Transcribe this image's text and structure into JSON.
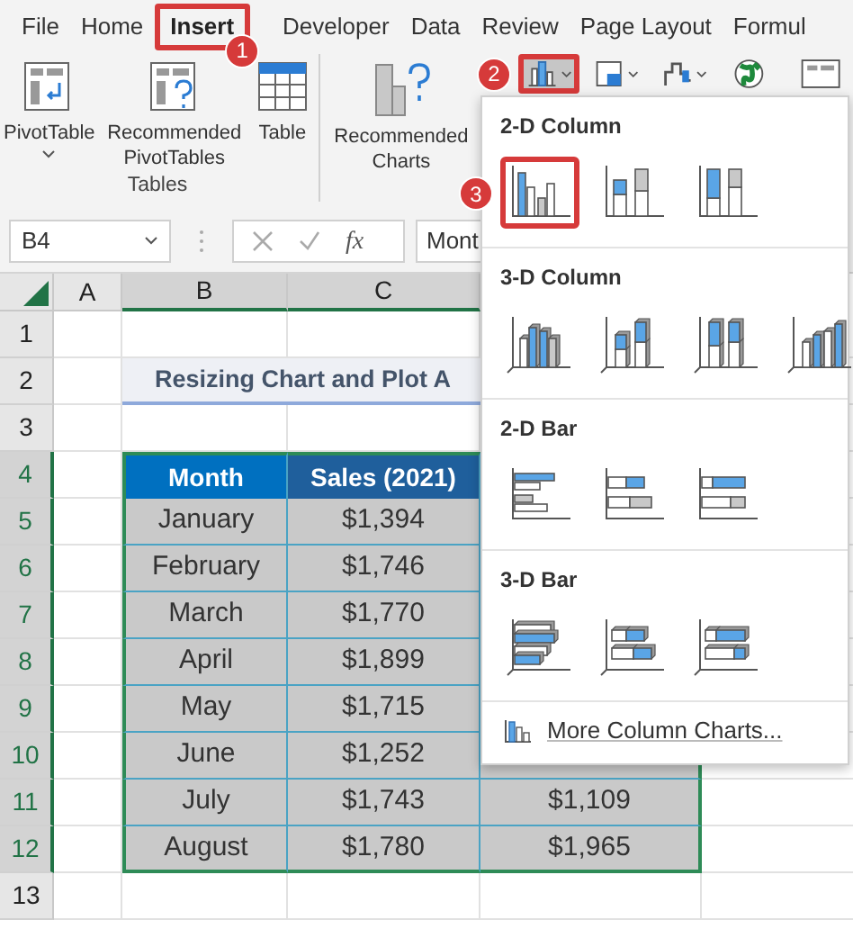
{
  "ribbon_tabs": [
    {
      "label": "File",
      "selected": false
    },
    {
      "label": "Home",
      "selected": false
    },
    {
      "label": "Insert",
      "selected": true,
      "badge": "1"
    },
    {
      "label": "Developer",
      "selected": false
    },
    {
      "label": "Data",
      "selected": false
    },
    {
      "label": "Review",
      "selected": false
    },
    {
      "label": "Page Layout",
      "selected": false
    },
    {
      "label": "Formul",
      "selected": false
    }
  ],
  "ribbon": {
    "tables_group": {
      "label": "Tables",
      "buttons": [
        {
          "kind": "pivottable",
          "label": "PivotTable",
          "has_menu": true
        },
        {
          "kind": "recommended",
          "label": "Recommended PivotTables",
          "has_menu": false
        },
        {
          "kind": "table",
          "label": "Table",
          "has_menu": false
        }
      ]
    },
    "recommended_charts": {
      "label": "Recommended Charts"
    },
    "chart_buttons": [
      {
        "kind": "column",
        "selected": true,
        "badge": "2"
      },
      {
        "kind": "hierarchy",
        "selected": false
      },
      {
        "kind": "waterfall",
        "selected": false
      },
      {
        "kind": "map",
        "selected": false
      },
      {
        "kind": "pivotchart",
        "selected": false
      }
    ]
  },
  "formula_bar": {
    "name_box": "B4",
    "function_label": "fx",
    "content": "Mont"
  },
  "column_headers": [
    {
      "label": "A",
      "selected": false
    },
    {
      "label": "B",
      "selected": true
    },
    {
      "label": "C",
      "selected": true
    }
  ],
  "row_headers": [
    {
      "label": "1",
      "selected": false
    },
    {
      "label": "2",
      "selected": false
    },
    {
      "label": "3",
      "selected": false
    },
    {
      "label": "4",
      "selected": true
    },
    {
      "label": "5",
      "selected": true
    },
    {
      "label": "6",
      "selected": true
    },
    {
      "label": "7",
      "selected": true
    },
    {
      "label": "8",
      "selected": true
    },
    {
      "label": "9",
      "selected": true
    },
    {
      "label": "10",
      "selected": true
    },
    {
      "label": "11",
      "selected": true
    },
    {
      "label": "12",
      "selected": true
    },
    {
      "label": "13",
      "selected": false
    }
  ],
  "sheet_title": "Resizing Chart and Plot A",
  "table": {
    "columns": [
      "Month",
      "Sales (2021)"
    ],
    "rows": [
      {
        "month": "January",
        "sales_2021": "$1,394"
      },
      {
        "month": "February",
        "sales_2021": "$1,746"
      },
      {
        "month": "March",
        "sales_2021": "$1,770"
      },
      {
        "month": "April",
        "sales_2021": "$1,899"
      },
      {
        "month": "May",
        "sales_2021": "$1,715"
      },
      {
        "month": "June",
        "sales_2021": "$1,252"
      },
      {
        "month": "July",
        "sales_2021": "$1,743",
        "column_3": "$1,109"
      },
      {
        "month": "August",
        "sales_2021": "$1,780",
        "column_3": "$1,965"
      }
    ]
  },
  "chart_menu": {
    "sections": [
      {
        "title": "2-D Column",
        "kind": "column",
        "options": [
          {
            "kind": "clustered",
            "selected": true,
            "badge": "3"
          },
          {
            "kind": "stacked",
            "selected": false
          },
          {
            "kind": "percent",
            "selected": false
          }
        ]
      },
      {
        "title": "3-D Column",
        "kind": "column3d",
        "options": [
          {
            "kind": "clustered",
            "selected": false
          },
          {
            "kind": "stacked",
            "selected": false
          },
          {
            "kind": "percent",
            "selected": false
          },
          {
            "kind": "depth",
            "selected": false
          }
        ]
      },
      {
        "title": "2-D Bar",
        "kind": "bar",
        "options": [
          {
            "kind": "clustered",
            "selected": false
          },
          {
            "kind": "stacked",
            "selected": false
          },
          {
            "kind": "percent",
            "selected": false
          }
        ]
      },
      {
        "title": "3-D Bar",
        "kind": "bar3d",
        "options": [
          {
            "kind": "clustered",
            "selected": false
          },
          {
            "kind": "stacked",
            "selected": false
          },
          {
            "kind": "percent",
            "selected": false
          }
        ]
      }
    ],
    "more_link": "More Column Charts..."
  }
}
